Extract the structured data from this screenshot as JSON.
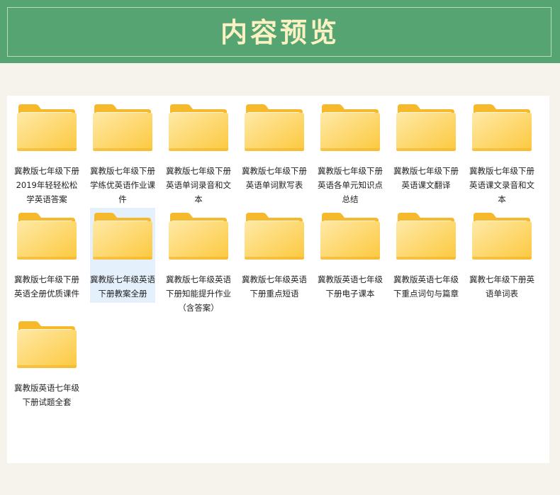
{
  "header": {
    "title": "内容预览"
  },
  "folders": [
    {
      "label": "冀教版七年级下册2019年轻轻松松学英语答案",
      "selected": false
    },
    {
      "label": "冀教版七年级下册学练优英语作业课件",
      "selected": false
    },
    {
      "label": "冀教版七年级下册英语单词录音和文本",
      "selected": false
    },
    {
      "label": "冀教版七年级下册英语单词默写表",
      "selected": false
    },
    {
      "label": "冀教版七年级下册英语各单元知识点总结",
      "selected": false
    },
    {
      "label": "冀教版七年级下册英语课文翻译",
      "selected": false
    },
    {
      "label": "冀教版七年级下册英语课文录音和文本",
      "selected": false
    },
    {
      "label": "冀教版七年级下册英语全册优质课件",
      "selected": false
    },
    {
      "label": "冀教版七年级英语下册教案全册",
      "selected": true
    },
    {
      "label": "冀教版七年级英语下册知能提升作业（含答案）",
      "selected": false
    },
    {
      "label": "冀教版七年级英语下册重点短语",
      "selected": false
    },
    {
      "label": "冀教版英语七年级下册电子课本",
      "selected": false
    },
    {
      "label": "冀教版英语七年级下重点词句与篇章",
      "selected": false
    },
    {
      "label": "冀教七年级下册英语单词表",
      "selected": false
    },
    {
      "label": "冀教版英语七年级下册试题全套",
      "selected": false
    }
  ],
  "icon": "folder-icon"
}
